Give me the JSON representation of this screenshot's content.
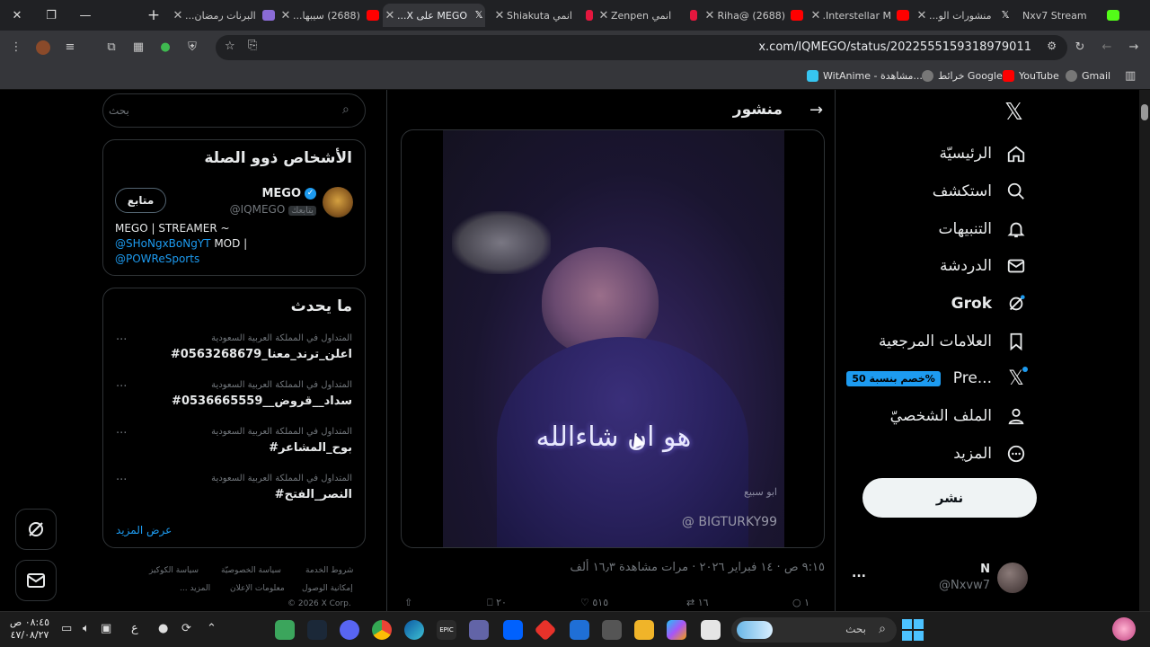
{
  "browser": {
    "tabs": [
      {
        "label": "Nxv7 Stream",
        "fav_color": "#53fc18"
      },
      {
        "label": "منشورات الو...",
        "fav_color": "#e7e9ea"
      },
      {
        "label": "Interstellar M...",
        "fav_color": "#ff0000"
      },
      {
        "label": "(2688) @Riha...",
        "fav_color": "#ff0000"
      },
      {
        "label": "انمي Zenpen",
        "fav_color": "#e3173e"
      },
      {
        "label": "انمي Shiakuta",
        "fav_color": "#e3173e"
      },
      {
        "label": "MEGO على X...",
        "fav_color": "#e7e9ea"
      },
      {
        "label": "(2688) سيبها...",
        "fav_color": "#ff0000"
      },
      {
        "label": "البرنات رمضان...",
        "fav_color": "#8a6bd6"
      }
    ],
    "url": "x.com/IQMEGO/status/2022555159318979011",
    "bookmarks": [
      "Gmail",
      "YouTube",
      "خرائط Google",
      "WitAnime - مشاهدة..."
    ]
  },
  "nav": {
    "items": [
      {
        "label": "الرئيسيّة",
        "icon": "home-icon"
      },
      {
        "label": "استكشف",
        "icon": "search-icon"
      },
      {
        "label": "التنبيهات",
        "icon": "bell-icon"
      },
      {
        "label": "الدردشة",
        "icon": "mail-icon"
      },
      {
        "label": "Grok",
        "icon": "grok-icon"
      },
      {
        "label": "العلامات المرجعية",
        "icon": "bookmark-icon"
      },
      {
        "label": "Pre...",
        "icon": "x-logo-icon"
      },
      {
        "label": "الملف الشخصيّ",
        "icon": "person-icon"
      },
      {
        "label": "المزيد",
        "icon": "more-circle-icon"
      }
    ],
    "premium_badge": "خصم بنسبة 50%",
    "post_button": "نشر",
    "account": {
      "name": "N",
      "handle": "@Nxvw7",
      "more": "..."
    }
  },
  "post": {
    "header_title": "منشور",
    "video_caption": "هو ان شاءالله",
    "video_watermark": "@ BIGTURKY99",
    "video_signature": "ابو سبيع",
    "meta_time": "٩:١٥ ص · ١٤ فبراير ٢٠٢٦",
    "meta_views": "· مرات مشاهدة ١٦٫٣ ألف",
    "actions": {
      "replies": "١",
      "reposts": "١٦",
      "likes": "٥١٥",
      "bookmarks": "٢٠"
    }
  },
  "sidebar": {
    "search_placeholder": "بحث",
    "related": {
      "title": "الأشخاص ذوو الصلة",
      "name": "MEGO",
      "handle": "@IQMEGO",
      "follows_you": "يتابعك",
      "follow_button": "متابع",
      "bio_line1": "MEGO | STREAMER ~",
      "bio_mention1": "@SHoNgxBoNgYT",
      "bio_mid": " MOD |",
      "bio_mention2": "@POWReSports"
    },
    "trending": {
      "title": "ما يحدث",
      "items": [
        {
          "meta": "المتداول في المملكة العربية السعودية",
          "name": "#اعلن_ترند_معنا_0563268679"
        },
        {
          "meta": "المتداول في المملكة العربية السعودية",
          "name": "#سداد__قروض__0536665559"
        },
        {
          "meta": "المتداول في المملكة العربية السعودية",
          "name": "#بوح_المشاعر"
        },
        {
          "meta": "المتداول في المملكة العربية السعودية",
          "name": "#النصر_الفتح"
        }
      ],
      "show_more": "عرض المزيد"
    },
    "footer": {
      "terms": "شروط الخدمة",
      "privacy": "سياسة الخصوصيّة",
      "cookies": "سياسة الكوكيز",
      "accessibility": "إمكانية الوصول",
      "ads": "معلومات الإعلان",
      "more": "... المزيد",
      "copyright": "© 2026 X Corp."
    }
  },
  "taskbar": {
    "search_placeholder": "بحث",
    "clock_time": "٠٨:٤٥ ص",
    "clock_date": "٤٧/٠٨/٢٧",
    "lang": "ع"
  }
}
